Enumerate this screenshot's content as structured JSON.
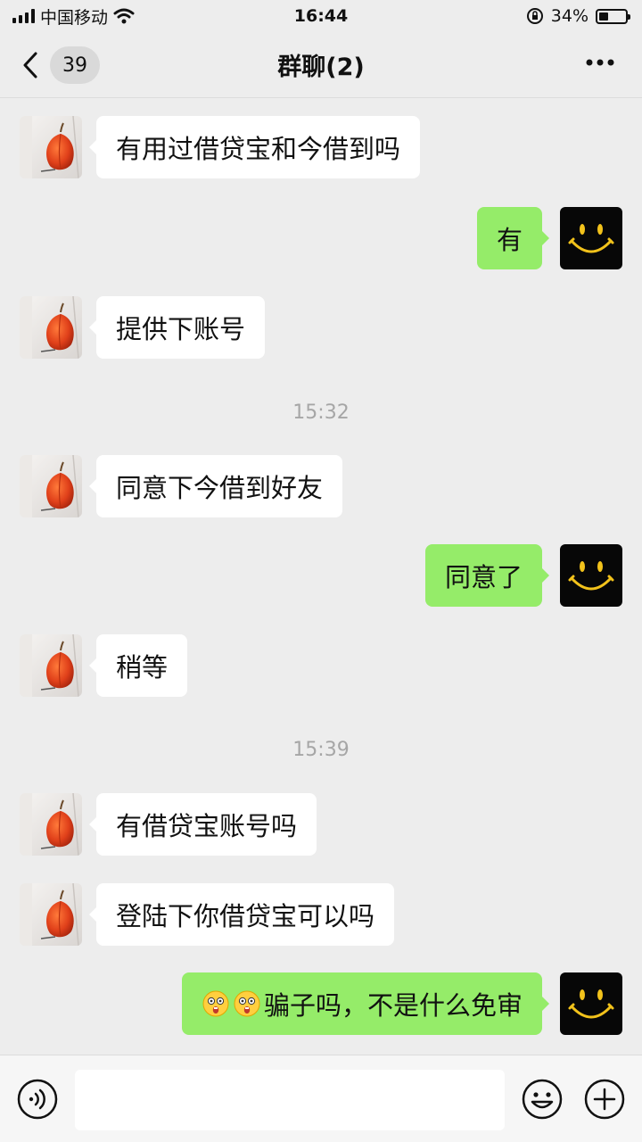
{
  "status_bar": {
    "carrier": "中国移动",
    "time": "16:44",
    "battery_text": "34%",
    "battery_level": 0.34
  },
  "nav": {
    "unread_count": "39",
    "title": "群聊(2)"
  },
  "messages": [
    {
      "side": "left",
      "text": "有用过借贷宝和今借到吗"
    },
    {
      "side": "right",
      "text": "有"
    },
    {
      "side": "left",
      "text": "提供下账号"
    },
    {
      "timestamp": "15:32"
    },
    {
      "side": "left",
      "text": "同意下今借到好友"
    },
    {
      "side": "right",
      "text": "同意了"
    },
    {
      "side": "left",
      "text": "稍等"
    },
    {
      "timestamp": "15:39"
    },
    {
      "side": "left",
      "text": "有借贷宝账号吗"
    },
    {
      "side": "left",
      "text": "登陆下你借贷宝可以吗"
    },
    {
      "side": "right",
      "text": "骗子吗，不是什么免审",
      "emoji_prefix": [
        "shocked-face-icon",
        "shocked-face-icon"
      ]
    }
  ],
  "colors": {
    "background": "#ededed",
    "sent_bubble": "#95ec69",
    "received_bubble": "#ffffff",
    "timestamp": "#a6a6a6"
  },
  "input": {
    "placeholder": ""
  }
}
